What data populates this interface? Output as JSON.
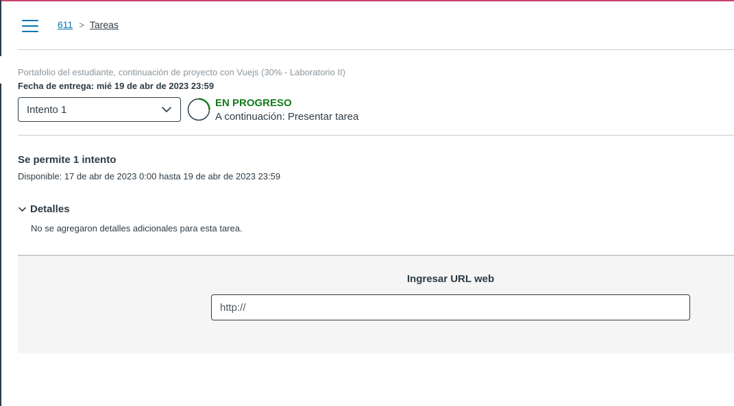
{
  "breadcrumb": {
    "course": "611",
    "separator": ">",
    "section": "Tareas"
  },
  "assignment": {
    "title": "Portafolio del estudiante, continuación de proyecto con Vuejs (30% - Laboratorio II)",
    "due_date": "Fecha de entrega: mié 19 de abr de 2023 23:59"
  },
  "attempt": {
    "selected": "Intento 1"
  },
  "status": {
    "state": "EN PROGRESO",
    "next_step": "A continuación: Presentar tarea",
    "color": "#127a1b"
  },
  "availability": {
    "attempts_allowed": "Se permite 1 intento",
    "window": "Disponible: 17 de abr de 2023 0:00 hasta 19 de abr de 2023 23:59"
  },
  "details": {
    "label": "Detalles",
    "text": "No se agregaron detalles adicionales para esta tarea."
  },
  "submission": {
    "label": "Ingresar URL web",
    "placeholder": "http://"
  },
  "colors": {
    "link": "#0374b5",
    "accent_top": "#c9426d"
  }
}
